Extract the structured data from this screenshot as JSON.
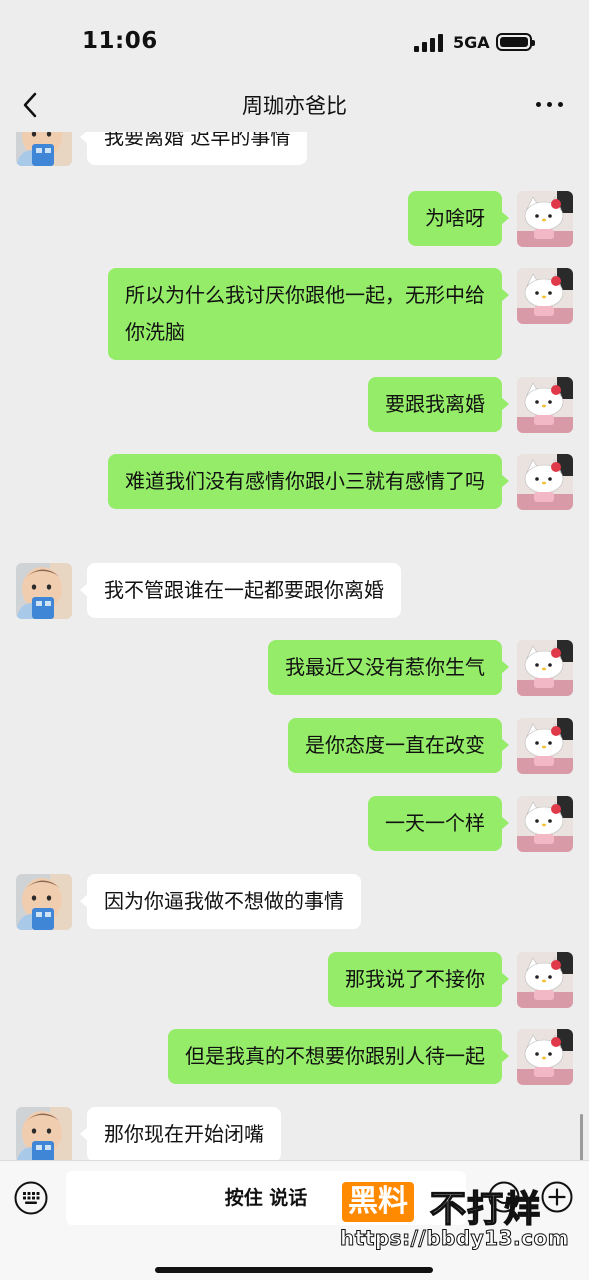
{
  "status_bar": {
    "time": "11:06",
    "network": "5GA"
  },
  "header": {
    "title": "周珈亦爸比"
  },
  "messages": [
    {
      "side": "left",
      "text": "我要离婚 迟早的事情"
    },
    {
      "side": "right",
      "text": "为啥呀"
    },
    {
      "side": "right",
      "text": "所以为什么我讨厌你跟他一起，无形中给你洗脑"
    },
    {
      "side": "right",
      "text": "要跟我离婚"
    },
    {
      "side": "right",
      "text": "难道我们没有感情你跟小三就有感情了吗"
    },
    {
      "side": "left",
      "text": "我不管跟谁在一起都要跟你离婚"
    },
    {
      "side": "right",
      "text": "我最近又没有惹你生气"
    },
    {
      "side": "right",
      "text": "是你态度一直在改变"
    },
    {
      "side": "right",
      "text": "一天一个样"
    },
    {
      "side": "left",
      "text": "因为你逼我做不想做的事情"
    },
    {
      "side": "right",
      "text": "那我说了不接你"
    },
    {
      "side": "right",
      "text": "但是我真的不想要你跟别人待一起"
    },
    {
      "side": "left",
      "text": "那你现在开始闭嘴"
    }
  ],
  "input_bar": {
    "hold_to_talk_label": "按住 说话"
  },
  "watermark": {
    "badge": "黑料",
    "text": "不打烊",
    "url": "https://bbdy13.com"
  },
  "colors": {
    "sent_bubble": "#95ec69",
    "received_bubble": "#ffffff",
    "background": "#ededed"
  }
}
